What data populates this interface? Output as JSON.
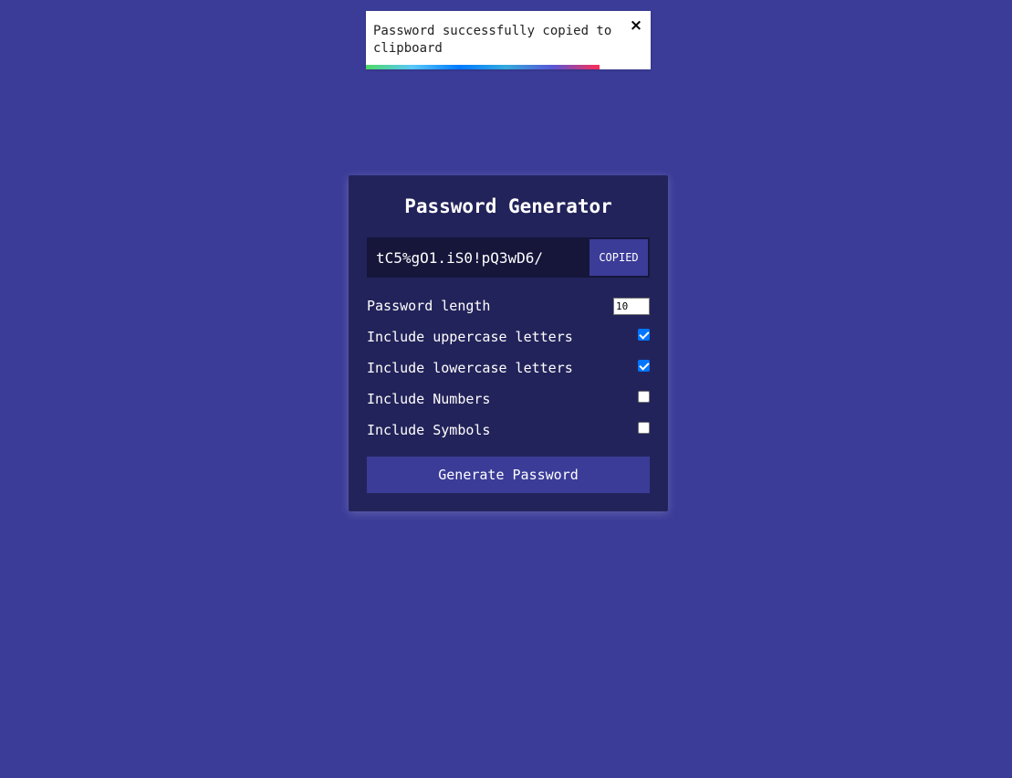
{
  "toast": {
    "message": "Password successfully copied to clipboard",
    "close_icon": "×",
    "progress_fraction": 0.82,
    "progress_gradient": [
      "#4cd964",
      "#5ac8fa",
      "#007aff",
      "#34aadc",
      "#5856d6",
      "#ff2d55"
    ]
  },
  "card": {
    "title": "Password Generator",
    "result": {
      "value": "tC5%gO1.iS0!pQ3wD6/",
      "copy_label": "COPIED"
    },
    "settings": {
      "length": {
        "label": "Password length",
        "value": "10"
      },
      "uppercase": {
        "label": "Include uppercase letters",
        "checked": true
      },
      "lowercase": {
        "label": "Include lowercase letters",
        "checked": true
      },
      "numbers": {
        "label": "Include Numbers",
        "checked": false
      },
      "symbols": {
        "label": "Include Symbols",
        "checked": false
      }
    },
    "generate_label": "Generate Password"
  },
  "colors": {
    "background": "#3b3c98",
    "card": "#23235b",
    "result_bg": "#16163b",
    "button": "#3b3c98",
    "checkbox_accent": "#0075ff"
  }
}
